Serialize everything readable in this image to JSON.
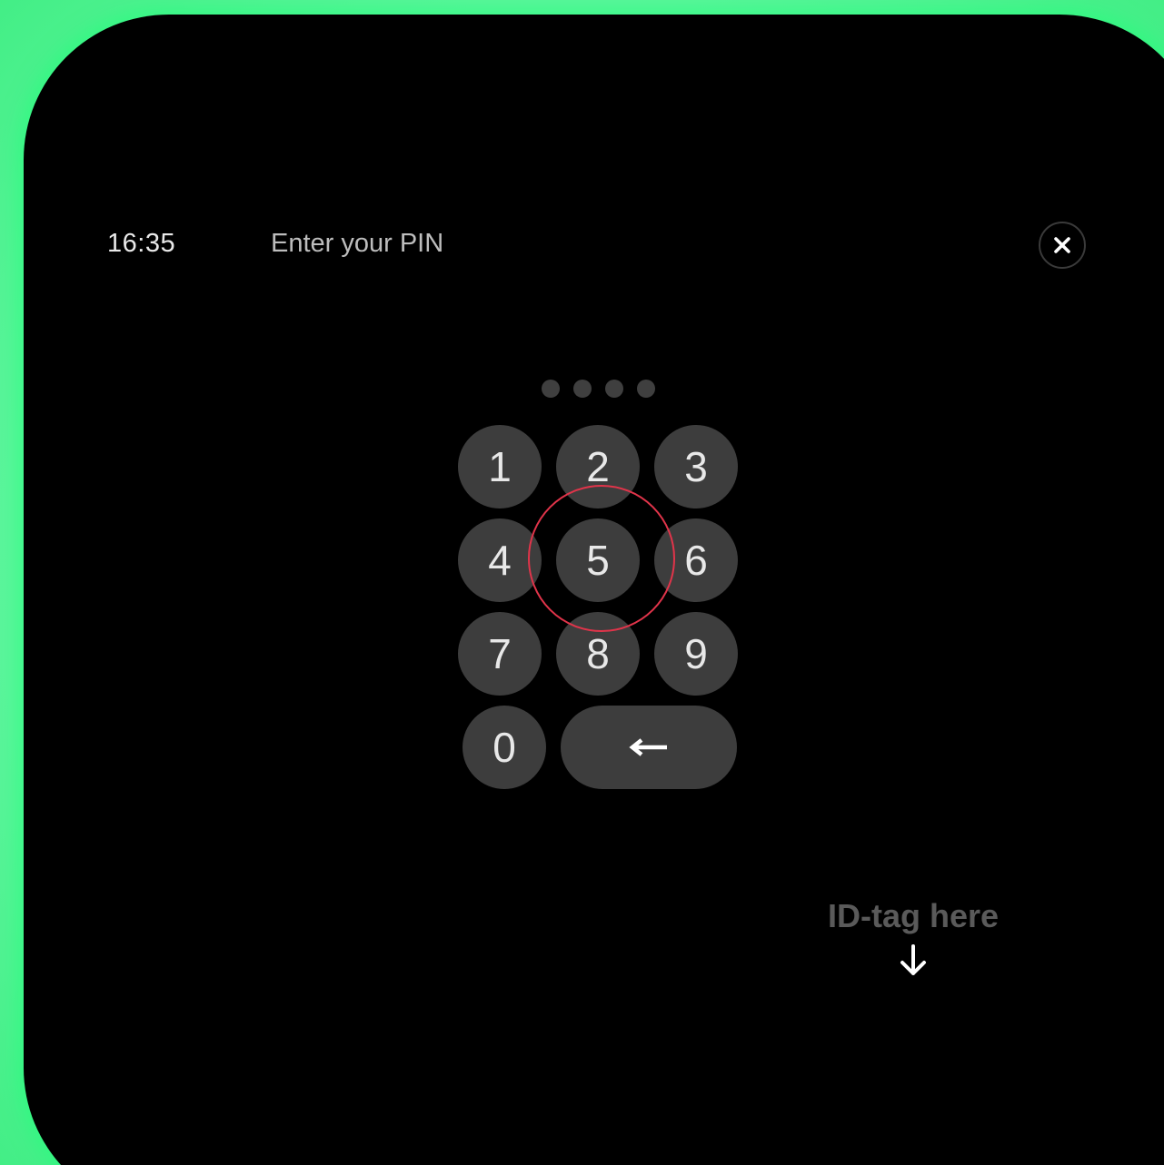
{
  "status": {
    "time": "16:35",
    "prompt": "Enter your PIN"
  },
  "pin": {
    "dots_count": 4
  },
  "keypad": {
    "keys": [
      "1",
      "2",
      "3",
      "4",
      "5",
      "6",
      "7",
      "8",
      "9",
      "0"
    ],
    "backspace_icon": "left-arrow-icon"
  },
  "close": {
    "icon": "close-icon"
  },
  "id_tag": {
    "label": "ID-tag here",
    "icon": "down-arrow-icon"
  },
  "colors": {
    "accent_glow": "#4ef28e",
    "highlight": "#e0344a",
    "key_bg": "#3d3d3d"
  }
}
